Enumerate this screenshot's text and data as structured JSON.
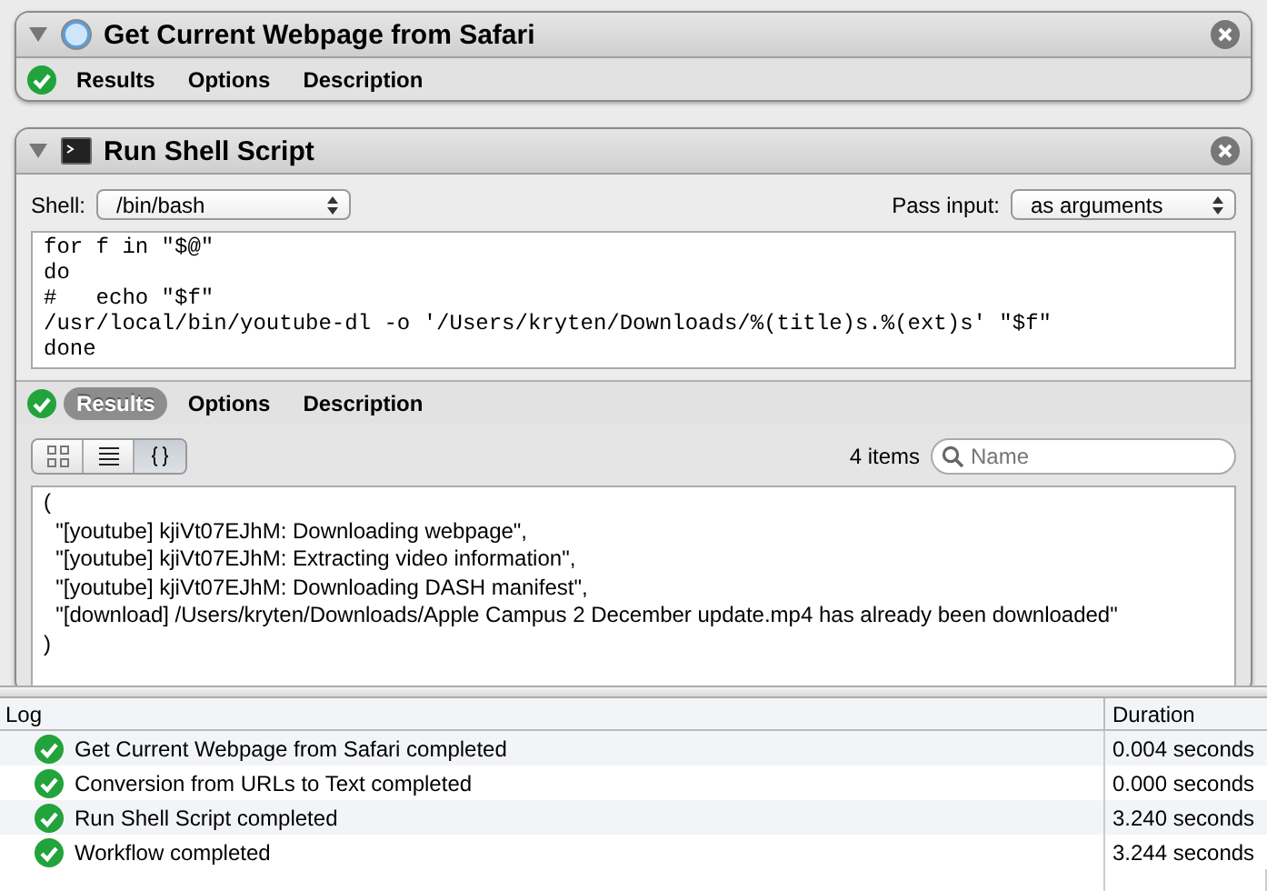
{
  "actions": [
    {
      "title": "Get Current Webpage from Safari",
      "expanded": true,
      "completed": true,
      "tabs": [
        {
          "label": "Results",
          "selected": false
        },
        {
          "label": "Options",
          "selected": false
        },
        {
          "label": "Description",
          "selected": false
        }
      ]
    },
    {
      "title": "Run Shell Script",
      "expanded": true,
      "completed": true,
      "shell": {
        "label": "Shell:",
        "value": "/bin/bash"
      },
      "pass_input": {
        "label": "Pass input:",
        "value": "as arguments"
      },
      "script": [
        "for f in \"$@\"",
        "do",
        "#   echo \"$f\"",
        "/usr/local/bin/youtube-dl -o '/Users/kryten/Downloads/%(title)s.%(ext)s' \"$f\"",
        "done"
      ],
      "tabs": [
        {
          "label": "Results",
          "selected": true
        },
        {
          "label": "Options",
          "selected": false
        },
        {
          "label": "Description",
          "selected": false
        }
      ],
      "results": {
        "views": [
          {
            "kind": "icons",
            "selected": false
          },
          {
            "kind": "list",
            "selected": false
          },
          {
            "kind": "braces",
            "selected": true
          }
        ],
        "count": "4 items",
        "search": {
          "placeholder": "Name"
        },
        "lines": [
          "(",
          "  \"[youtube] kjiVt07EJhM: Downloading webpage\",",
          "  \"[youtube] kjiVt07EJhM: Extracting video information\",",
          "  \"[youtube] kjiVt07EJhM: Downloading DASH manifest\",",
          "  \"[download] /Users/kryten/Downloads/Apple Campus 2 December update.mp4 has already been downloaded\"",
          ")"
        ]
      }
    }
  ],
  "log": {
    "columns": [
      "Log",
      "Duration"
    ],
    "rows": [
      {
        "message": "Get Current Webpage from Safari completed",
        "duration": "0.004 seconds",
        "completed": true
      },
      {
        "message": "Conversion from URLs to Text completed",
        "duration": "0.000 seconds",
        "completed": true
      },
      {
        "message": "Run Shell Script completed",
        "duration": "3.240 seconds",
        "completed": true
      },
      {
        "message": "Workflow completed",
        "duration": "3.244 seconds",
        "completed": true
      }
    ]
  }
}
